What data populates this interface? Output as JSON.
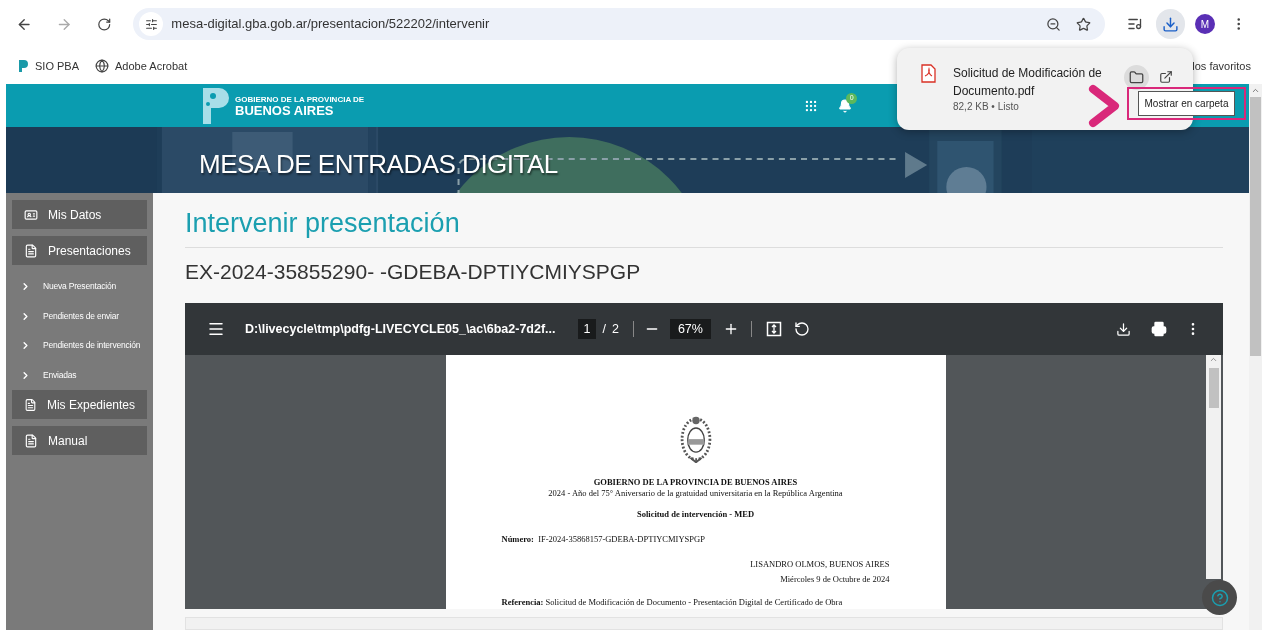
{
  "browser": {
    "url": "mesa-digital.gba.gob.ar/presentacion/522202/intervenir",
    "avatar": "M",
    "bookmarks": [
      {
        "label": "SIO PBA",
        "kind": "sio"
      },
      {
        "label": "Adobe Acrobat",
        "kind": "globe"
      }
    ],
    "bookmarks_overflow": "los favoritos"
  },
  "download_popup": {
    "filename": "Solicitud de Modificación de Documento.pdf",
    "meta": "82,2 KB • Listo",
    "tooltip": "Mostrar en carpeta"
  },
  "header": {
    "logo_small": "GOBIERNO DE LA PROVINCIA DE",
    "logo_big": "BUENOS AIRES",
    "notifications": "0"
  },
  "banner": {
    "title": "MESA DE ENTRADAS DIGITAL"
  },
  "sidebar": {
    "items": [
      {
        "label": "Mis Datos",
        "kind": "main"
      },
      {
        "label": "Presentaciones",
        "kind": "main"
      },
      {
        "label": "Nueva Presentación",
        "kind": "sub"
      },
      {
        "label": "Pendientes de enviar",
        "kind": "sub"
      },
      {
        "label": "Pendientes de intervención",
        "kind": "sub"
      },
      {
        "label": "Enviadas",
        "kind": "sub"
      },
      {
        "label": "Mis Expedientes",
        "kind": "main"
      },
      {
        "label": "Manual",
        "kind": "main"
      }
    ]
  },
  "page": {
    "title": "Intervenir presentación",
    "expediente": "EX-2024-35855290- -GDEBA-DPTIYCMIYSPGP"
  },
  "pdf_viewer": {
    "filename": "D:\\livecycle\\tmp\\pdfg-LIVECYCLE05_\\ac\\6ba2-7d2f...",
    "page": "1",
    "separator": "/",
    "pages": "2",
    "zoom": "67%",
    "document": {
      "heading": "GOBIERNO DE LA PROVINCIA DE BUENOS AIRES",
      "motto": "2024 - Año del 75° Aniversario de la gratuidad universitaria en la República Argentina",
      "subject": "Solicitud de intervención - MED",
      "number": "**Número:**  IF-2024-35868157-GDEBA-DPTIYCMIYSPGP",
      "place": "LISANDRO OLMOS, BUENOS AIRES",
      "date": "Miércoles 9 de Octubre de 2024",
      "reference": "**Referencia:** Solicitud de Modificación de Documento - Presentación Digital de Certificado de Obra"
    }
  }
}
